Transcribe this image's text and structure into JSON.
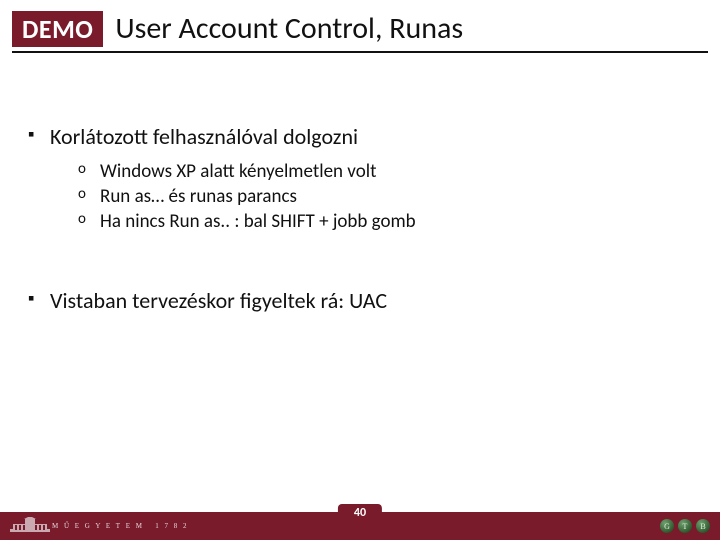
{
  "header": {
    "badge": "DEMO",
    "title": "User Account Control, Runas"
  },
  "bullets": {
    "b1": "Korlátozott felhasználóval dolgozni",
    "b1_subs": {
      "s1": "Windows XP alatt kényelmetlen volt",
      "s2": "Run as… és runas parancs",
      "s3": "Ha nincs Run as.. : bal SHIFT + jobb gomb"
    },
    "b2": "Vistaban tervezéskor figyeltek rá: UAC"
  },
  "footer": {
    "page": "40",
    "left_text": "M Ű E G Y E T E M   1 7 8 2",
    "dots": {
      "d1": "G",
      "d2": "T",
      "d3": "B"
    }
  }
}
